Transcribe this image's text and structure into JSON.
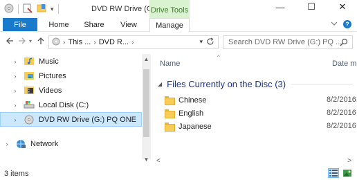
{
  "window": {
    "title": "DVD RW Drive (G:) P...",
    "context_tab": "Drive Tools",
    "minimize": "—",
    "maximize": "☐",
    "close": "✕"
  },
  "ribbon": {
    "tabs": [
      "File",
      "Home",
      "Share",
      "View",
      "Manage"
    ],
    "collapse_icon": "chevron-down-icon",
    "help": "?"
  },
  "address": {
    "crumbs": [
      "This ...",
      "DVD R..."
    ],
    "search_placeholder": "Search DVD RW Drive (G:) PQ ..."
  },
  "nav": {
    "items": [
      {
        "label": "Music",
        "icon": "music-folder-icon"
      },
      {
        "label": "Pictures",
        "icon": "pictures-folder-icon"
      },
      {
        "label": "Videos",
        "icon": "videos-folder-icon"
      },
      {
        "label": "Local Disk (C:)",
        "icon": "local-disk-icon"
      },
      {
        "label": "DVD RW Drive (G:) PQ ONE",
        "icon": "dvd-drive-icon"
      },
      {
        "label": "Network",
        "icon": "network-icon"
      }
    ]
  },
  "content": {
    "columns": {
      "name": "Name",
      "date": "Date mod"
    },
    "group_title": "Files Currently on the Disc (3)",
    "files": [
      {
        "name": "Chinese",
        "date": "8/2/2016"
      },
      {
        "name": "English",
        "date": "8/2/2016"
      },
      {
        "name": "Japanese",
        "date": "8/2/2016"
      }
    ]
  },
  "status": {
    "count": "3 items"
  },
  "colors": {
    "accent": "#1979ca",
    "selection": "#cce8ff",
    "context_tab_bg": "#d9f2d0"
  }
}
